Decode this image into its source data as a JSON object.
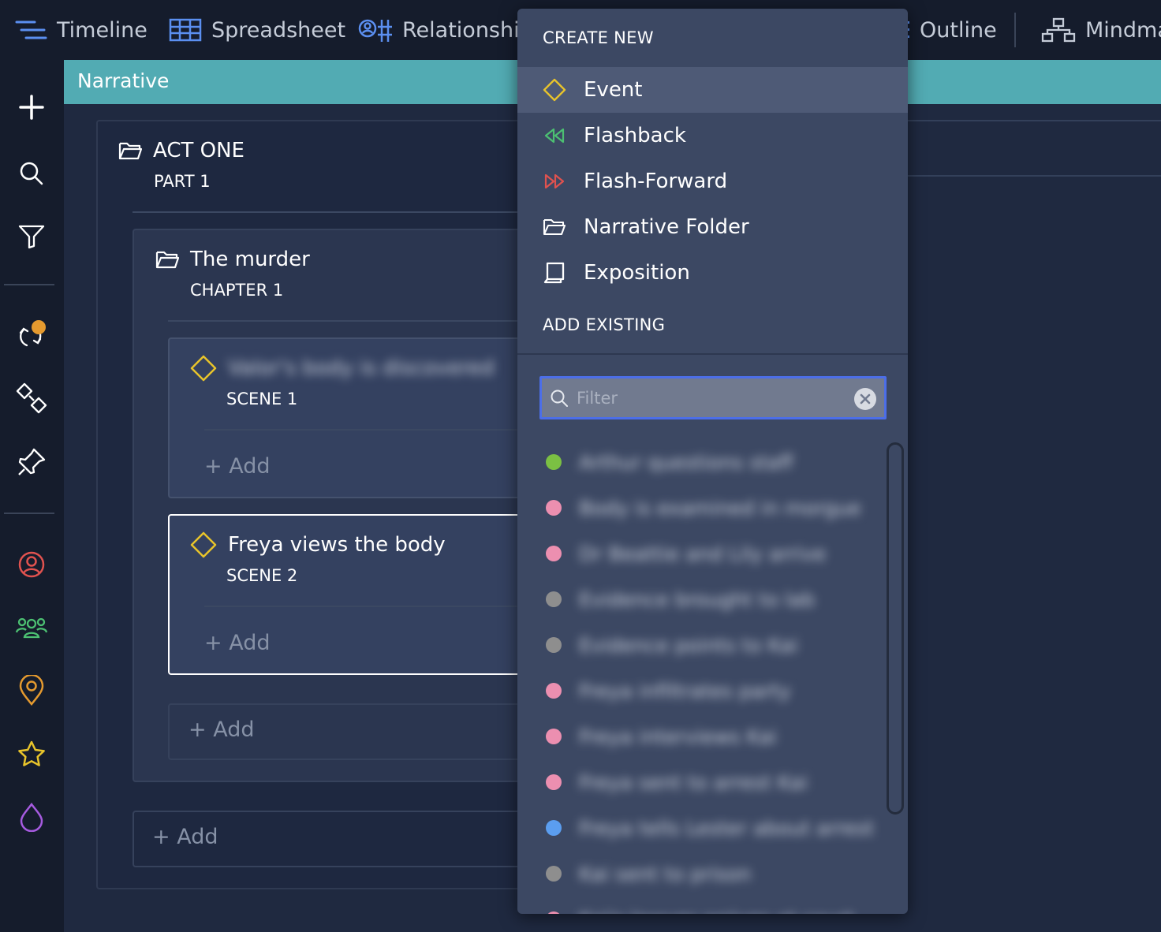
{
  "topnav": {
    "items": [
      {
        "label": "Timeline",
        "icon": "timeline-icon"
      },
      {
        "label": "Spreadsheet",
        "icon": "spreadsheet-icon"
      },
      {
        "label": "Relationship",
        "icon": "relationship-icon"
      },
      {
        "label": "Outline",
        "icon": "outline-icon"
      },
      {
        "label": "Mindmap",
        "icon": "mindmap-icon"
      }
    ]
  },
  "sidebar": {
    "icons": [
      "plus-icon",
      "search-icon",
      "filter-icon",
      "sync-icon",
      "shapes-icon",
      "pin-icon",
      "character-icon",
      "group-icon",
      "location-icon",
      "star-icon",
      "drop-icon"
    ],
    "accent_colors": {
      "character": "#e0524f",
      "group": "#4cc072",
      "location": "#e59a2f",
      "star": "#e8c42b",
      "drop": "#a65be0",
      "badge": "#e59a2f"
    }
  },
  "header": {
    "title": "Narrative",
    "color": "#52abb3"
  },
  "act": {
    "title": "ACT ONE",
    "subtitle": "PART 1",
    "add_label": "+ Add"
  },
  "chapter": {
    "title": "The murder",
    "subtitle": "CHAPTER 1",
    "add_label": "+ Add"
  },
  "scenes": [
    {
      "title": "Valor's body is discovered",
      "subtitle": "SCENE 1",
      "add_label": "+ Add",
      "blurred": true
    },
    {
      "title": "Freya views the body",
      "subtitle": "SCENE 2",
      "add_label": "+ Add",
      "blurred": false
    }
  ],
  "dropdown": {
    "create_new_label": "CREATE NEW",
    "create_items": [
      {
        "label": "Event",
        "icon": "diamond-icon",
        "color": "#e8c42b"
      },
      {
        "label": "Flashback",
        "icon": "rewind-icon",
        "color": "#4cc072"
      },
      {
        "label": "Flash-Forward",
        "icon": "fast-forward-icon",
        "color": "#e0524f"
      },
      {
        "label": "Narrative Folder",
        "icon": "folder-icon",
        "color": "#ffffff"
      },
      {
        "label": "Exposition",
        "icon": "book-icon",
        "color": "#ffffff"
      }
    ],
    "add_existing_label": "ADD EXISTING",
    "filter_placeholder": "Filter",
    "results": [
      {
        "label": "Arthur questions staff",
        "color": "#7bc043"
      },
      {
        "label": "Body is examined in morgue",
        "color": "#ec8fb0"
      },
      {
        "label": "Dr Beattie and Lily arrive",
        "color": "#ec8fb0"
      },
      {
        "label": "Evidence brought to lab",
        "color": "#8e8e8e"
      },
      {
        "label": "Evidence points to Kai",
        "color": "#8e8e8e"
      },
      {
        "label": "Freya infiltrates party",
        "color": "#ec8fb0"
      },
      {
        "label": "Freya interviews Kai",
        "color": "#ec8fb0"
      },
      {
        "label": "Freya sent to arrest Kai",
        "color": "#ec8fb0"
      },
      {
        "label": "Freya tells Lester about arrest",
        "color": "#5b9ef0"
      },
      {
        "label": "Kai sent to prison",
        "color": "#8e8e8e"
      },
      {
        "label": "Kai's lawyer arrives at court",
        "color": "#ec8fb0"
      }
    ]
  }
}
